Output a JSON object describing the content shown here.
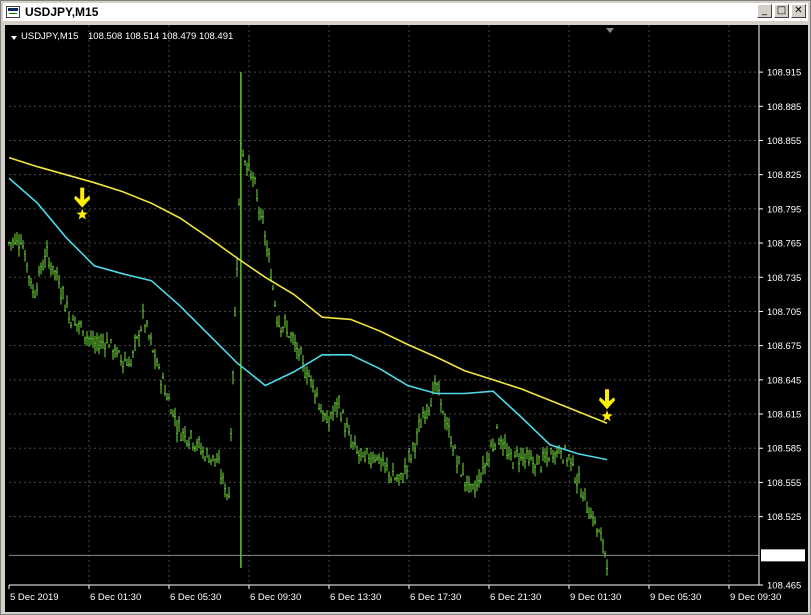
{
  "window": {
    "title": "USDJPY,M15",
    "buttons": {
      "minimize": "_",
      "maximize": "□",
      "close": "✕"
    }
  },
  "chart_header": {
    "symbol_label": "USDJPY,M15",
    "ohlc": "108.508 108.514 108.479 108.491"
  },
  "colors": {
    "background": "#000000",
    "grid": "#4a4a4a",
    "candle": "#6fdc3c",
    "ma_slow": "#f0e640",
    "ma_fast": "#4fd8e8",
    "signal": "#ffee00",
    "text": "#ffffff"
  },
  "chart_data": {
    "type": "line",
    "ylim": [
      108.465,
      108.93
    ],
    "y_ticks": [
      "108.915",
      "108.885",
      "108.855",
      "108.825",
      "108.795",
      "108.765",
      "108.735",
      "108.705",
      "108.675",
      "108.645",
      "108.615",
      "108.585",
      "108.555",
      "108.525",
      "108.491",
      "108.465"
    ],
    "x_ticks": [
      "5 Dec 2019",
      "6 Dec 01:30",
      "6 Dec 05:30",
      "6 Dec 09:30",
      "6 Dec 13:30",
      "6 Dec 17:30",
      "6 Dec 21:30",
      "9 Dec 01:30",
      "9 Dec 05:30",
      "9 Dec 09:30"
    ],
    "current_price": "108.491",
    "series": [
      {
        "key": "ma_slow",
        "values": [
          108.84,
          108.832,
          108.825,
          108.818,
          108.81,
          108.8,
          108.787,
          108.77,
          108.752,
          108.735,
          108.72,
          108.7,
          108.698,
          108.688,
          108.676,
          108.665,
          108.653,
          108.645,
          108.637,
          108.627,
          108.617,
          108.607
        ]
      },
      {
        "key": "ma_fast",
        "values": [
          108.822,
          108.8,
          108.77,
          108.745,
          108.738,
          108.732,
          108.71,
          108.685,
          108.66,
          108.64,
          108.652,
          108.667,
          108.667,
          108.655,
          108.64,
          108.633,
          108.633,
          108.635,
          108.612,
          108.588,
          108.58,
          108.575
        ]
      },
      {
        "key": "price",
        "values": [
          108.765,
          108.77,
          108.72,
          108.755,
          108.735,
          108.7,
          108.69,
          108.675,
          108.68,
          108.665,
          108.66,
          108.7,
          108.662,
          108.63,
          108.6,
          108.595,
          108.58,
          108.575,
          108.54,
          108.85,
          108.82,
          108.77,
          108.7,
          108.685,
          108.66,
          108.64,
          108.605,
          108.625,
          108.59,
          108.575,
          108.58,
          108.565,
          108.555,
          108.58,
          108.615,
          108.64,
          108.6,
          108.565,
          108.545,
          108.57,
          108.6,
          108.575,
          108.58,
          108.57,
          108.575,
          108.585,
          108.575,
          108.545,
          108.52,
          108.49
        ]
      }
    ],
    "signals": [
      {
        "x": 6,
        "y": 108.79
      },
      {
        "x": 49,
        "y": 108.613
      }
    ]
  }
}
